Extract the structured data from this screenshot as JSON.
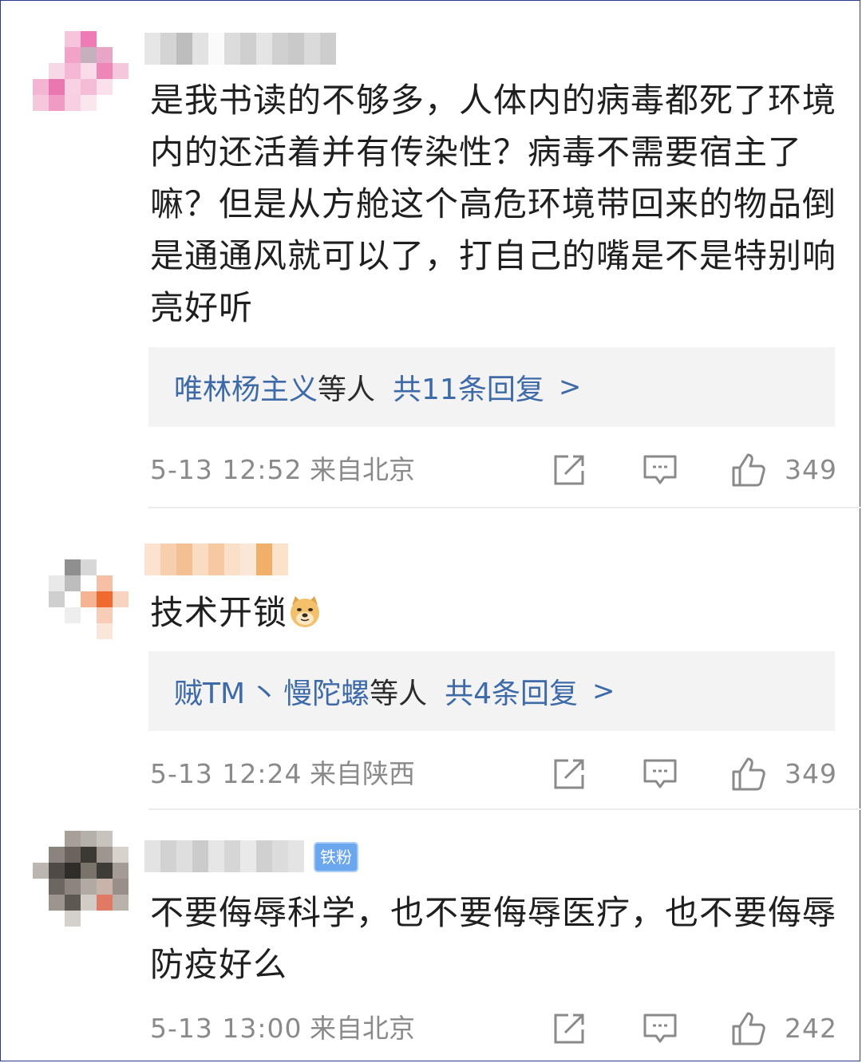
{
  "comments": [
    {
      "text": "是我书读的不够多，人体内的病毒都死了环境内的还活着并有传染性？病毒不需要宿主了嘛？但是从方舱这个高危环境带回来的物品倒是通通风就可以了，打自己的嘴是不是特别响亮好听",
      "replies": {
        "users": [
          "唯林杨主义"
        ],
        "suffix": "等人",
        "count_label": "共11条回复",
        "chevron": ">"
      },
      "time": "5-13 12:52",
      "location": "来自北京",
      "likes": "349",
      "icons": [
        "share-icon",
        "comment-icon",
        "like-icon"
      ]
    },
    {
      "text": "技术开锁",
      "emoji": "doge-emoji",
      "replies": {
        "users": [
          "贼TM",
          "慢陀螺"
        ],
        "separator": "丶",
        "suffix": "等人",
        "count_label": "共4条回复",
        "chevron": ">"
      },
      "time": "5-13 12:24",
      "location": "来自陕西",
      "likes": "349",
      "icons": [
        "share-icon",
        "comment-icon",
        "like-icon"
      ]
    },
    {
      "badge": "铁粉",
      "text": "不要侮辱科学，也不要侮辱医疗，也不要侮辱防疫好么",
      "time": "5-13 13:00",
      "location": "来自北京",
      "likes": "242",
      "icons": [
        "share-icon",
        "comment-icon",
        "like-icon"
      ]
    }
  ],
  "colors": {
    "link": "#3e6aa8",
    "meta": "#8a8a8a",
    "reply_box": "#f3f3f3",
    "badge": "#6aa7ee"
  }
}
